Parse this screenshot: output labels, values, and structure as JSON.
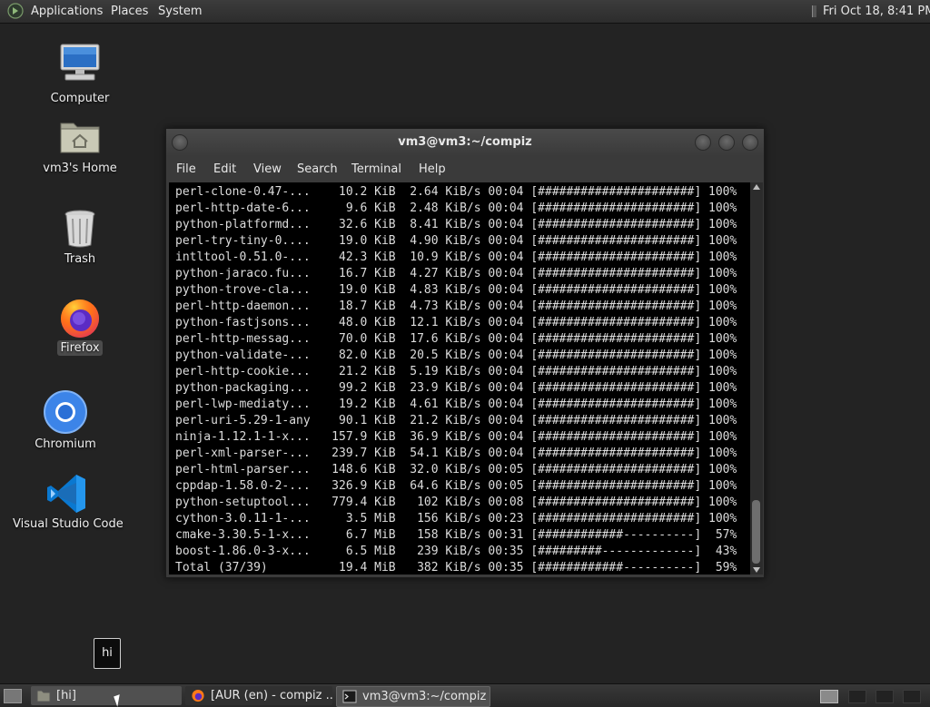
{
  "top_panel": {
    "menus": [
      "Applications",
      "Places",
      "System"
    ],
    "clock": "Fri Oct 18,  8:41 PM"
  },
  "desktop": {
    "icons": [
      {
        "label": "Computer",
        "icon": "computer-icon"
      },
      {
        "label": "vm3's Home",
        "icon": "home-folder-icon"
      },
      {
        "label": "Trash",
        "icon": "trash-icon"
      },
      {
        "label": "Firefox",
        "icon": "firefox-icon"
      },
      {
        "label": "Chromium",
        "icon": "chromium-icon"
      },
      {
        "label": "Visual Studio Code",
        "icon": "vscode-icon"
      }
    ]
  },
  "terminal": {
    "title": "vm3@vm3:~/compiz",
    "menu": [
      "File",
      "Edit",
      "View",
      "Search",
      "Terminal",
      "Help"
    ],
    "lines": [
      "perl-clone-0.47-...    10.2 KiB  2.64 KiB/s 00:04 [######################] 100%",
      "perl-http-date-6...     9.6 KiB  2.48 KiB/s 00:04 [######################] 100%",
      "python-platformd...    32.6 KiB  8.41 KiB/s 00:04 [######################] 100%",
      "perl-try-tiny-0....    19.0 KiB  4.90 KiB/s 00:04 [######################] 100%",
      "intltool-0.51.0-...    42.3 KiB  10.9 KiB/s 00:04 [######################] 100%",
      "python-jaraco.fu...    16.7 KiB  4.27 KiB/s 00:04 [######################] 100%",
      "python-trove-cla...    19.0 KiB  4.83 KiB/s 00:04 [######################] 100%",
      "perl-http-daemon...    18.7 KiB  4.73 KiB/s 00:04 [######################] 100%",
      "python-fastjsons...    48.0 KiB  12.1 KiB/s 00:04 [######################] 100%",
      "perl-http-messag...    70.0 KiB  17.6 KiB/s 00:04 [######################] 100%",
      "python-validate-...    82.0 KiB  20.5 KiB/s 00:04 [######################] 100%",
      "perl-http-cookie...    21.2 KiB  5.19 KiB/s 00:04 [######################] 100%",
      "python-packaging...    99.2 KiB  23.9 KiB/s 00:04 [######################] 100%",
      "perl-lwp-mediaty...    19.2 KiB  4.61 KiB/s 00:04 [######################] 100%",
      "perl-uri-5.29-1-any    90.1 KiB  21.2 KiB/s 00:04 [######################] 100%",
      "ninja-1.12.1-1-x...   157.9 KiB  36.9 KiB/s 00:04 [######################] 100%",
      "perl-xml-parser-...   239.7 KiB  54.1 KiB/s 00:04 [######################] 100%",
      "perl-html-parser...   148.6 KiB  32.0 KiB/s 00:05 [######################] 100%",
      "cppdap-1.58.0-2-...   326.9 KiB  64.6 KiB/s 00:05 [######################] 100%",
      "python-setuptool...   779.4 KiB   102 KiB/s 00:08 [######################] 100%",
      "cython-3.0.11-1-...     3.5 MiB   156 KiB/s 00:23 [######################] 100%",
      "cmake-3.30.5-1-x...     6.7 MiB   158 KiB/s 00:31 [############----------]  57%",
      "boost-1.86.0-3-x...     6.5 MiB   239 KiB/s 00:35 [#########-------------]  43%",
      "Total (37/39)          19.4 MiB   382 KiB/s 00:35 [############----------]  59%"
    ]
  },
  "tooltip": {
    "text": "hi"
  },
  "taskbar": {
    "tasks": [
      {
        "label": "[hi]",
        "icon": "folder-icon"
      },
      {
        "label": "[AUR (en) - compiz ...",
        "icon": "firefox-icon"
      },
      {
        "label": "vm3@vm3:~/compiz",
        "icon": "terminal-icon"
      }
    ],
    "workspaces": 4
  }
}
